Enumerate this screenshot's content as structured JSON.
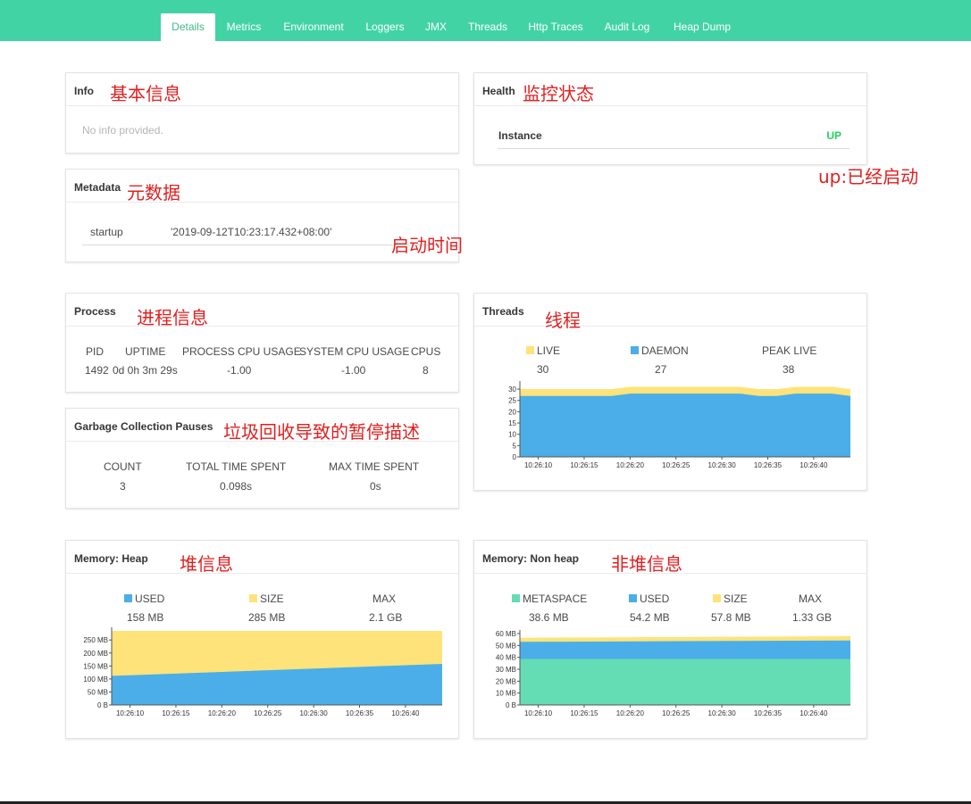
{
  "nav": {
    "tabs": [
      "Details",
      "Metrics",
      "Environment",
      "Loggers",
      "JMX",
      "Threads",
      "Http Traces",
      "Audit Log",
      "Heap Dump"
    ],
    "active": "Details"
  },
  "colors": {
    "accent": "#42d3a5",
    "blue": "#4baee8",
    "yellow": "#fde37a",
    "green": "#64dcb4",
    "up": "#23d160",
    "annotation": "#e02020"
  },
  "info": {
    "title": "Info",
    "empty_text": "No info provided.",
    "annotation": "基本信息"
  },
  "health": {
    "title": "Health",
    "annotation": "监控状态",
    "instance_label": "Instance",
    "status": "UP",
    "status_annotation": "up:已经启动"
  },
  "metadata": {
    "title": "Metadata",
    "annotation": "元数据",
    "key": "startup",
    "value": "'2019-09-12T10:23:17.432+08:00'",
    "value_annotation": "启动时间"
  },
  "process": {
    "title": "Process",
    "annotation": "进程信息",
    "headers": [
      "PID",
      "UPTIME",
      "PROCESS CPU USAGE",
      "SYSTEM CPU USAGE",
      "CPUS"
    ],
    "values": [
      "1492",
      "0d 0h 3m 29s",
      "-1.00",
      "-1.00",
      "8"
    ]
  },
  "gc": {
    "title": "Garbage Collection Pauses",
    "annotation": "垃圾回收导致的暂停描述",
    "headers": [
      "COUNT",
      "TOTAL TIME SPENT",
      "MAX TIME SPENT"
    ],
    "values": [
      "3",
      "0.098s",
      "0s"
    ]
  },
  "threads": {
    "title": "Threads",
    "annotation": "线程",
    "legend": [
      {
        "label": "LIVE",
        "value": "30",
        "color": "#fde37a"
      },
      {
        "label": "DAEMON",
        "value": "27",
        "color": "#4baee8"
      },
      {
        "label": "PEAK LIVE",
        "value": "38",
        "color": ""
      }
    ]
  },
  "heap": {
    "title": "Memory: Heap",
    "annotation": "堆信息",
    "legend": [
      {
        "label": "USED",
        "value": "158 MB",
        "color": "#4baee8"
      },
      {
        "label": "SIZE",
        "value": "285 MB",
        "color": "#fde37a"
      },
      {
        "label": "MAX",
        "value": "2.1 GB",
        "color": ""
      }
    ]
  },
  "nonheap": {
    "title": "Memory: Non heap",
    "annotation": "非堆信息",
    "legend": [
      {
        "label": "METASPACE",
        "value": "38.6 MB",
        "color": "#64dcb4"
      },
      {
        "label": "USED",
        "value": "54.2 MB",
        "color": "#4baee8"
      },
      {
        "label": "SIZE",
        "value": "57.8 MB",
        "color": "#fde37a"
      },
      {
        "label": "MAX",
        "value": "1.33 GB",
        "color": ""
      }
    ]
  },
  "chart_data": [
    {
      "id": "threads",
      "type": "area",
      "x": [
        "10:26:08",
        "10:26:10",
        "10:26:12",
        "10:26:14",
        "10:26:16",
        "10:26:18",
        "10:26:20",
        "10:26:22",
        "10:26:24",
        "10:26:26",
        "10:26:28",
        "10:26:30",
        "10:26:32",
        "10:26:34",
        "10:26:36",
        "10:26:38",
        "10:26:40",
        "10:26:42",
        "10:26:44"
      ],
      "xticks": [
        "10:26:10",
        "10:26:15",
        "10:26:20",
        "10:26:25",
        "10:26:30",
        "10:26:35",
        "10:26:40"
      ],
      "yticks": [
        "0",
        "5",
        "10",
        "15",
        "20",
        "25",
        "30"
      ],
      "ylim": [
        0,
        32
      ],
      "series": [
        {
          "name": "LIVE",
          "color": "#fde37a",
          "values": [
            30,
            30,
            30,
            30,
            30,
            30,
            31,
            31,
            31,
            31,
            31,
            31,
            31,
            30,
            30,
            31,
            31,
            31,
            30
          ]
        },
        {
          "name": "DAEMON",
          "color": "#4baee8",
          "values": [
            27,
            27,
            27,
            27,
            27,
            27,
            28,
            28,
            28,
            28,
            28,
            28,
            28,
            27,
            27,
            28,
            28,
            28,
            27
          ]
        }
      ]
    },
    {
      "id": "heap",
      "type": "area",
      "x": [
        "10:26:08",
        "10:26:44"
      ],
      "xticks": [
        "10:26:10",
        "10:26:15",
        "10:26:20",
        "10:26:25",
        "10:26:30",
        "10:26:35",
        "10:26:40"
      ],
      "yticks": [
        "0 B",
        "50 MB",
        "100 MB",
        "150 MB",
        "200 MB",
        "250 MB"
      ],
      "ylim": [
        0,
        285
      ],
      "series": [
        {
          "name": "SIZE",
          "color": "#fde37a",
          "values": [
            285,
            285
          ]
        },
        {
          "name": "USED",
          "color": "#4baee8",
          "values": [
            112,
            158
          ]
        }
      ]
    },
    {
      "id": "nonheap",
      "type": "area",
      "x": [
        "10:26:08",
        "10:26:44"
      ],
      "xticks": [
        "10:26:10",
        "10:26:15",
        "10:26:20",
        "10:26:25",
        "10:26:30",
        "10:26:35",
        "10:26:40"
      ],
      "yticks": [
        "0 B",
        "10 MB",
        "20 MB",
        "30 MB",
        "40 MB",
        "50 MB",
        "60 MB"
      ],
      "ylim": [
        0,
        60
      ],
      "series": [
        {
          "name": "SIZE",
          "color": "#fde37a",
          "values": [
            56.5,
            57.8
          ]
        },
        {
          "name": "USED",
          "color": "#4baee8",
          "values": [
            53,
            54.2
          ]
        },
        {
          "name": "METASPACE",
          "color": "#64dcb4",
          "values": [
            38.6,
            38.6
          ]
        }
      ]
    }
  ]
}
